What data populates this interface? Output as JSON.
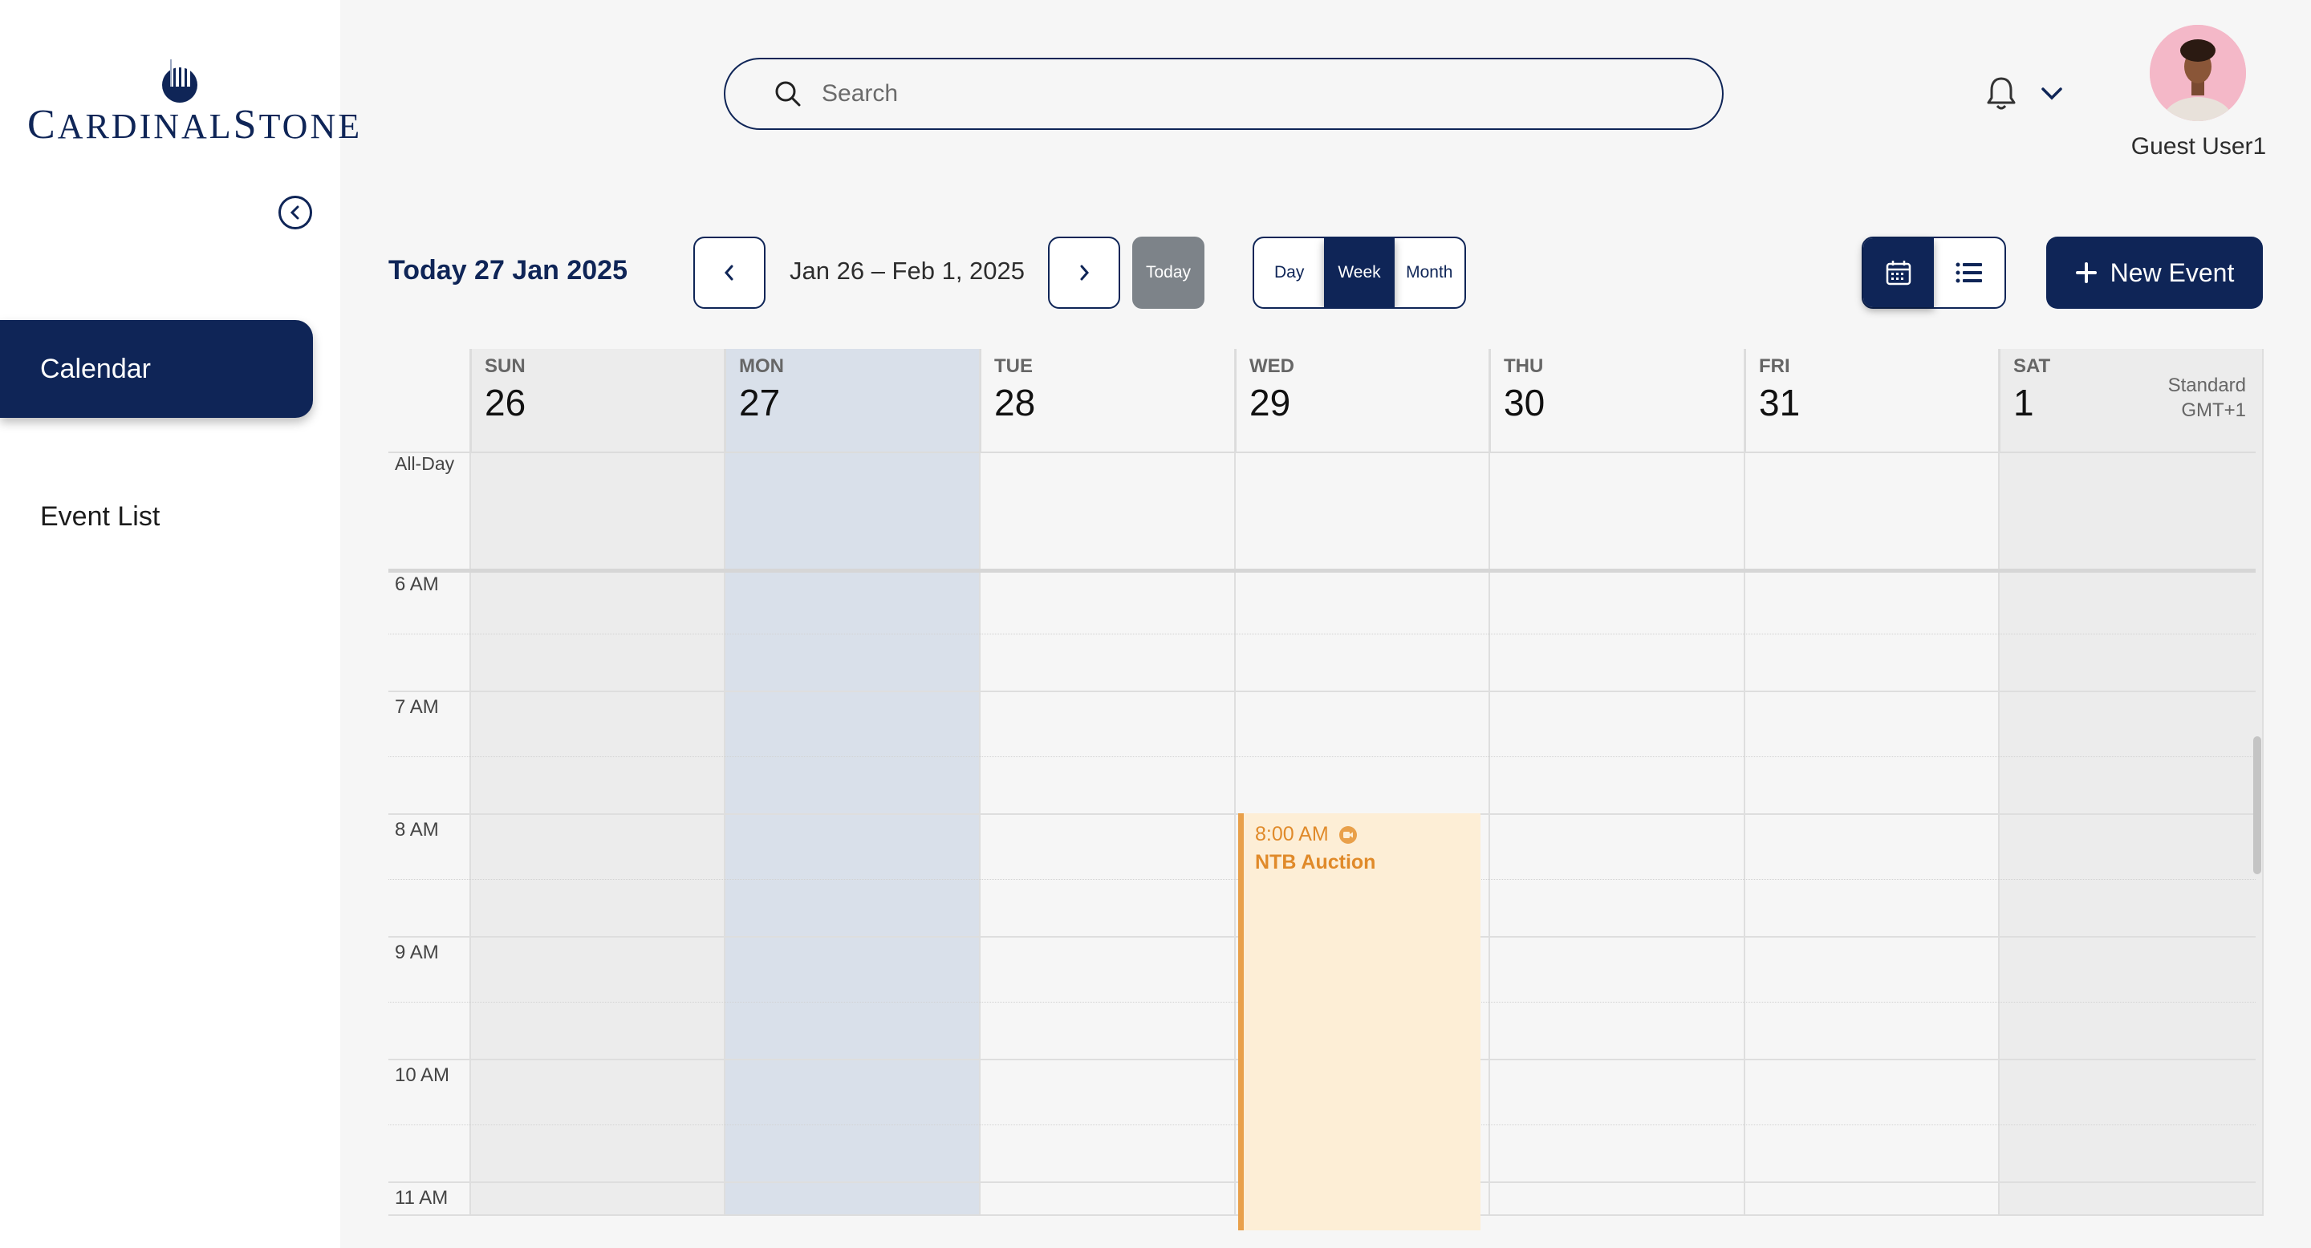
{
  "brand": {
    "logo_text_first": "C",
    "logo_text_rest": "ARDINAL",
    "logo_text_second": "S",
    "logo_text_second_rest": "TONE",
    "accent": "#0f2557"
  },
  "sidebar": {
    "items": [
      {
        "label": "Calendar",
        "active": true
      },
      {
        "label": "Event List",
        "active": false
      }
    ]
  },
  "header": {
    "search_placeholder": "Search",
    "user_name": "Guest User1"
  },
  "toolbar": {
    "today_label": "Today 27 Jan 2025",
    "date_range": "Jan 26 – Feb 1, 2025",
    "today_button": "Today",
    "views": [
      "Day",
      "Week",
      "Month"
    ],
    "active_view": "Week",
    "new_event_label": "New Event"
  },
  "calendar": {
    "days": [
      {
        "name": "SUN",
        "date": "26"
      },
      {
        "name": "MON",
        "date": "27"
      },
      {
        "name": "TUE",
        "date": "28"
      },
      {
        "name": "WED",
        "date": "29"
      },
      {
        "name": "THU",
        "date": "30"
      },
      {
        "name": "FRI",
        "date": "31"
      },
      {
        "name": "SAT",
        "date": "1"
      }
    ],
    "timezone_line1": "Standard",
    "timezone_line2": "GMT+1",
    "allday_label": "All-Day",
    "hours": [
      "6 AM",
      "7 AM",
      "8 AM",
      "9 AM",
      "10 AM",
      "11 AM"
    ],
    "event": {
      "time": "8:00 AM",
      "title": "NTB Auction",
      "day": "WED",
      "color": "#e9a04a"
    }
  }
}
